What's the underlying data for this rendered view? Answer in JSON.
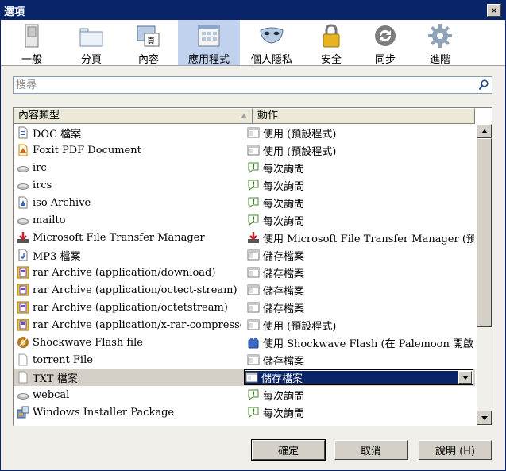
{
  "window": {
    "title": "選項",
    "close_label": "✕"
  },
  "panes": [
    {
      "label": "一般",
      "icon": "switch-icon"
    },
    {
      "label": "分頁",
      "icon": "tabs-icon"
    },
    {
      "label": "內容",
      "icon": "content-icon"
    },
    {
      "label": "應用程式",
      "icon": "applications-icon"
    },
    {
      "label": "個人隱私",
      "icon": "mask-icon"
    },
    {
      "label": "安全",
      "icon": "lock-icon"
    },
    {
      "label": "同步",
      "icon": "sync-icon"
    },
    {
      "label": "進階",
      "icon": "gear-icon"
    }
  ],
  "active_pane": "應用程式",
  "search": {
    "placeholder": "搜尋"
  },
  "table": {
    "columns": [
      "內容類型",
      "動作"
    ],
    "rows": [
      {
        "type": "DOC 檔案",
        "type_icon": "doc-file-icon",
        "action": "使用  (預設程式)",
        "action_icon": "default-app-icon"
      },
      {
        "type": "Foxit PDF Document",
        "type_icon": "pdf-file-icon",
        "action": "使用  (預設程式)",
        "action_icon": "default-app-icon"
      },
      {
        "type": "irc",
        "type_icon": "protocol-icon",
        "action": "每次詢問",
        "action_icon": "ask-icon"
      },
      {
        "type": "ircs",
        "type_icon": "protocol-icon",
        "action": "每次詢問",
        "action_icon": "ask-icon"
      },
      {
        "type": "iso Archive",
        "type_icon": "iso-file-icon",
        "action": "每次詢問",
        "action_icon": "ask-icon"
      },
      {
        "type": "mailto",
        "type_icon": "protocol-icon",
        "action": "每次詢問",
        "action_icon": "ask-icon"
      },
      {
        "type": "Microsoft File Transfer Manager",
        "type_icon": "download-manager-icon",
        "action": "使用 Microsoft File Transfer Manager (預…",
        "action_icon": "download-manager-icon"
      },
      {
        "type": "MP3 檔案",
        "type_icon": "audio-file-icon",
        "action": "儲存檔案",
        "action_icon": "save-file-icon"
      },
      {
        "type": "rar Archive (application/download)",
        "type_icon": "rar-file-icon",
        "action": "儲存檔案",
        "action_icon": "save-file-icon"
      },
      {
        "type": "rar Archive (application/octect-stream)",
        "type_icon": "rar-file-icon",
        "action": "儲存檔案",
        "action_icon": "save-file-icon"
      },
      {
        "type": "rar Archive (application/octetstream)",
        "type_icon": "rar-file-icon",
        "action": "儲存檔案",
        "action_icon": "save-file-icon"
      },
      {
        "type": "rar Archive (application/x-rar-compressed)",
        "type_icon": "rar-file-icon",
        "action": "使用  (預設程式)",
        "action_icon": "default-app-icon"
      },
      {
        "type": "Shockwave Flash file",
        "type_icon": "flash-file-icon",
        "action": "使用 Shockwave Flash (在 Palemoon 開啟)",
        "action_icon": "plugin-icon"
      },
      {
        "type": "torrent File",
        "type_icon": "blank-file-icon",
        "action": "儲存檔案",
        "action_icon": "save-file-icon"
      },
      {
        "type": "TXT 檔案",
        "type_icon": "text-file-icon",
        "action": "儲存檔案",
        "action_icon": "save-file-icon",
        "selected": true
      },
      {
        "type": "webcal",
        "type_icon": "protocol-icon",
        "action": "每次詢問",
        "action_icon": "ask-icon"
      },
      {
        "type": "Windows Installer Package",
        "type_icon": "installer-icon",
        "action": "每次詢問",
        "action_icon": "ask-icon"
      }
    ]
  },
  "buttons": {
    "ok": "確定",
    "cancel": "取消",
    "help": "說明 (H)"
  }
}
